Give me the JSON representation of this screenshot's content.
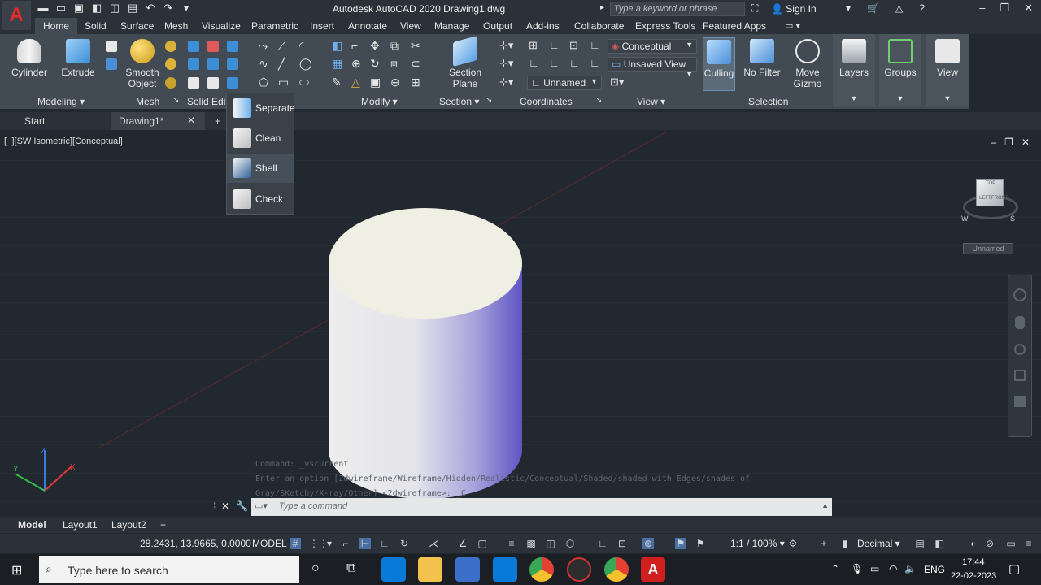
{
  "titlebar": {
    "app_title": "Autodesk AutoCAD 2020   Drawing1.dwg",
    "search_placeholder": "Type a keyword or phrase",
    "sign_in": "Sign In",
    "logo": "A"
  },
  "ribbon_tabs": [
    "Home",
    "Solid",
    "Surface",
    "Mesh",
    "Visualize",
    "Parametric",
    "Insert",
    "Annotate",
    "View",
    "Manage",
    "Output",
    "Add-ins",
    "Collaborate",
    "Express Tools",
    "Featured Apps"
  ],
  "ribbon": {
    "cylinder": "Cylinder",
    "extrude": "Extrude",
    "smooth_object": "Smooth Object",
    "section_plane": "Section Plane",
    "culling": "Culling",
    "no_filter": "No Filter",
    "move_gizmo": "Move Gizmo",
    "layers": "Layers",
    "groups": "Groups",
    "view": "View",
    "visual_style": "Conceptual",
    "saved_view": "Unsaved View",
    "ucs_name": "Unnamed",
    "panel_labels": {
      "modeling": "Modeling",
      "mesh": "Mesh",
      "solid_edit": "Solid Edit",
      "modify": "Modify",
      "section": "Section",
      "coordinates": "Coordinates",
      "view": "View",
      "selection": "Selection"
    }
  },
  "solid_menu": {
    "items": [
      "Separate",
      "Clean",
      "Shell",
      "Check"
    ]
  },
  "doc_tabs": {
    "start": "Start",
    "drawing": "Drawing1*",
    "add": "+"
  },
  "viewport": {
    "label": "[−][SW Isometric][Conceptual]",
    "viewcube_name": "Unnamed",
    "viewcube_faces": [
      "TOP",
      "LEFT",
      "FRONT"
    ],
    "compass": [
      "W",
      "S"
    ]
  },
  "command": {
    "history_1": "Command: _vscurrent",
    "history_2": "Enter an option [2dwireframe/Wireframe/Hidden/Realistic/Conceptual/Shaded/shaded with Edges/shades of Gray/SKetchy/X-ray/Other] <2dwireframe>: _C",
    "placeholder": "Type a command"
  },
  "layout_tabs": [
    "Model",
    "Layout1",
    "Layout2"
  ],
  "statusbar": {
    "coords": "28.2431, 13.9665, 0.0000",
    "model": "MODEL",
    "scale": "1:1 / 100%",
    "units": "Decimal"
  },
  "taskbar": {
    "search": "Type here to search",
    "lang": "ENG",
    "time": "17:44",
    "date": "22-02-2023"
  },
  "colors": {
    "accent_blue": "#4a8fd9",
    "autocad_red": "#d11f1f",
    "background": "#212830"
  }
}
